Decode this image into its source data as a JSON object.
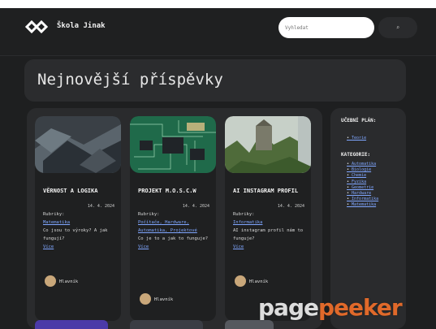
{
  "header": {
    "brand": "Škola Jinak",
    "search_placeholder": "Vyhledat",
    "search_button": "⌕"
  },
  "main": {
    "heading": "Nejnovější příspěvky"
  },
  "posts": [
    {
      "title": "VĚRNOST A LOGIKA",
      "date": "14. 4. 2024",
      "category_label": "Rubriky:",
      "category": "Matematika",
      "excerpt": "Co jsou to výroky? A jak fungují?",
      "more": "Více",
      "author": "Hlavník"
    },
    {
      "title": "PROJEKT M.O.S.C.W",
      "date": "14. 4. 2024",
      "category_label": "Rubriky:",
      "category": "Počítače, Hardware, Automatika, Projektové",
      "excerpt": "Co je to a jak to funguje?",
      "more": "Více",
      "author": "Hlavník"
    },
    {
      "title": "AI INSTAGRAM PROFIL",
      "date": "14. 4. 2024",
      "category_label": "Rubriky:",
      "category": "Informatika",
      "excerpt": "AI instagram profil nám to funguje?",
      "more": "Více",
      "author": "Hlavník"
    }
  ],
  "sidebar": {
    "plan_title": "UČEBNÍ PLÁN:",
    "plan_items": [
      "Teorie"
    ],
    "cat_title": "KATEGORIE:",
    "cat_items": [
      "Automatika",
      "Biologie",
      "Chemie",
      "Fyzika",
      "Geometrie",
      "Hardware",
      "Informatika",
      "Matematika"
    ]
  },
  "watermark": {
    "part1": "page",
    "part2": "peeker"
  }
}
